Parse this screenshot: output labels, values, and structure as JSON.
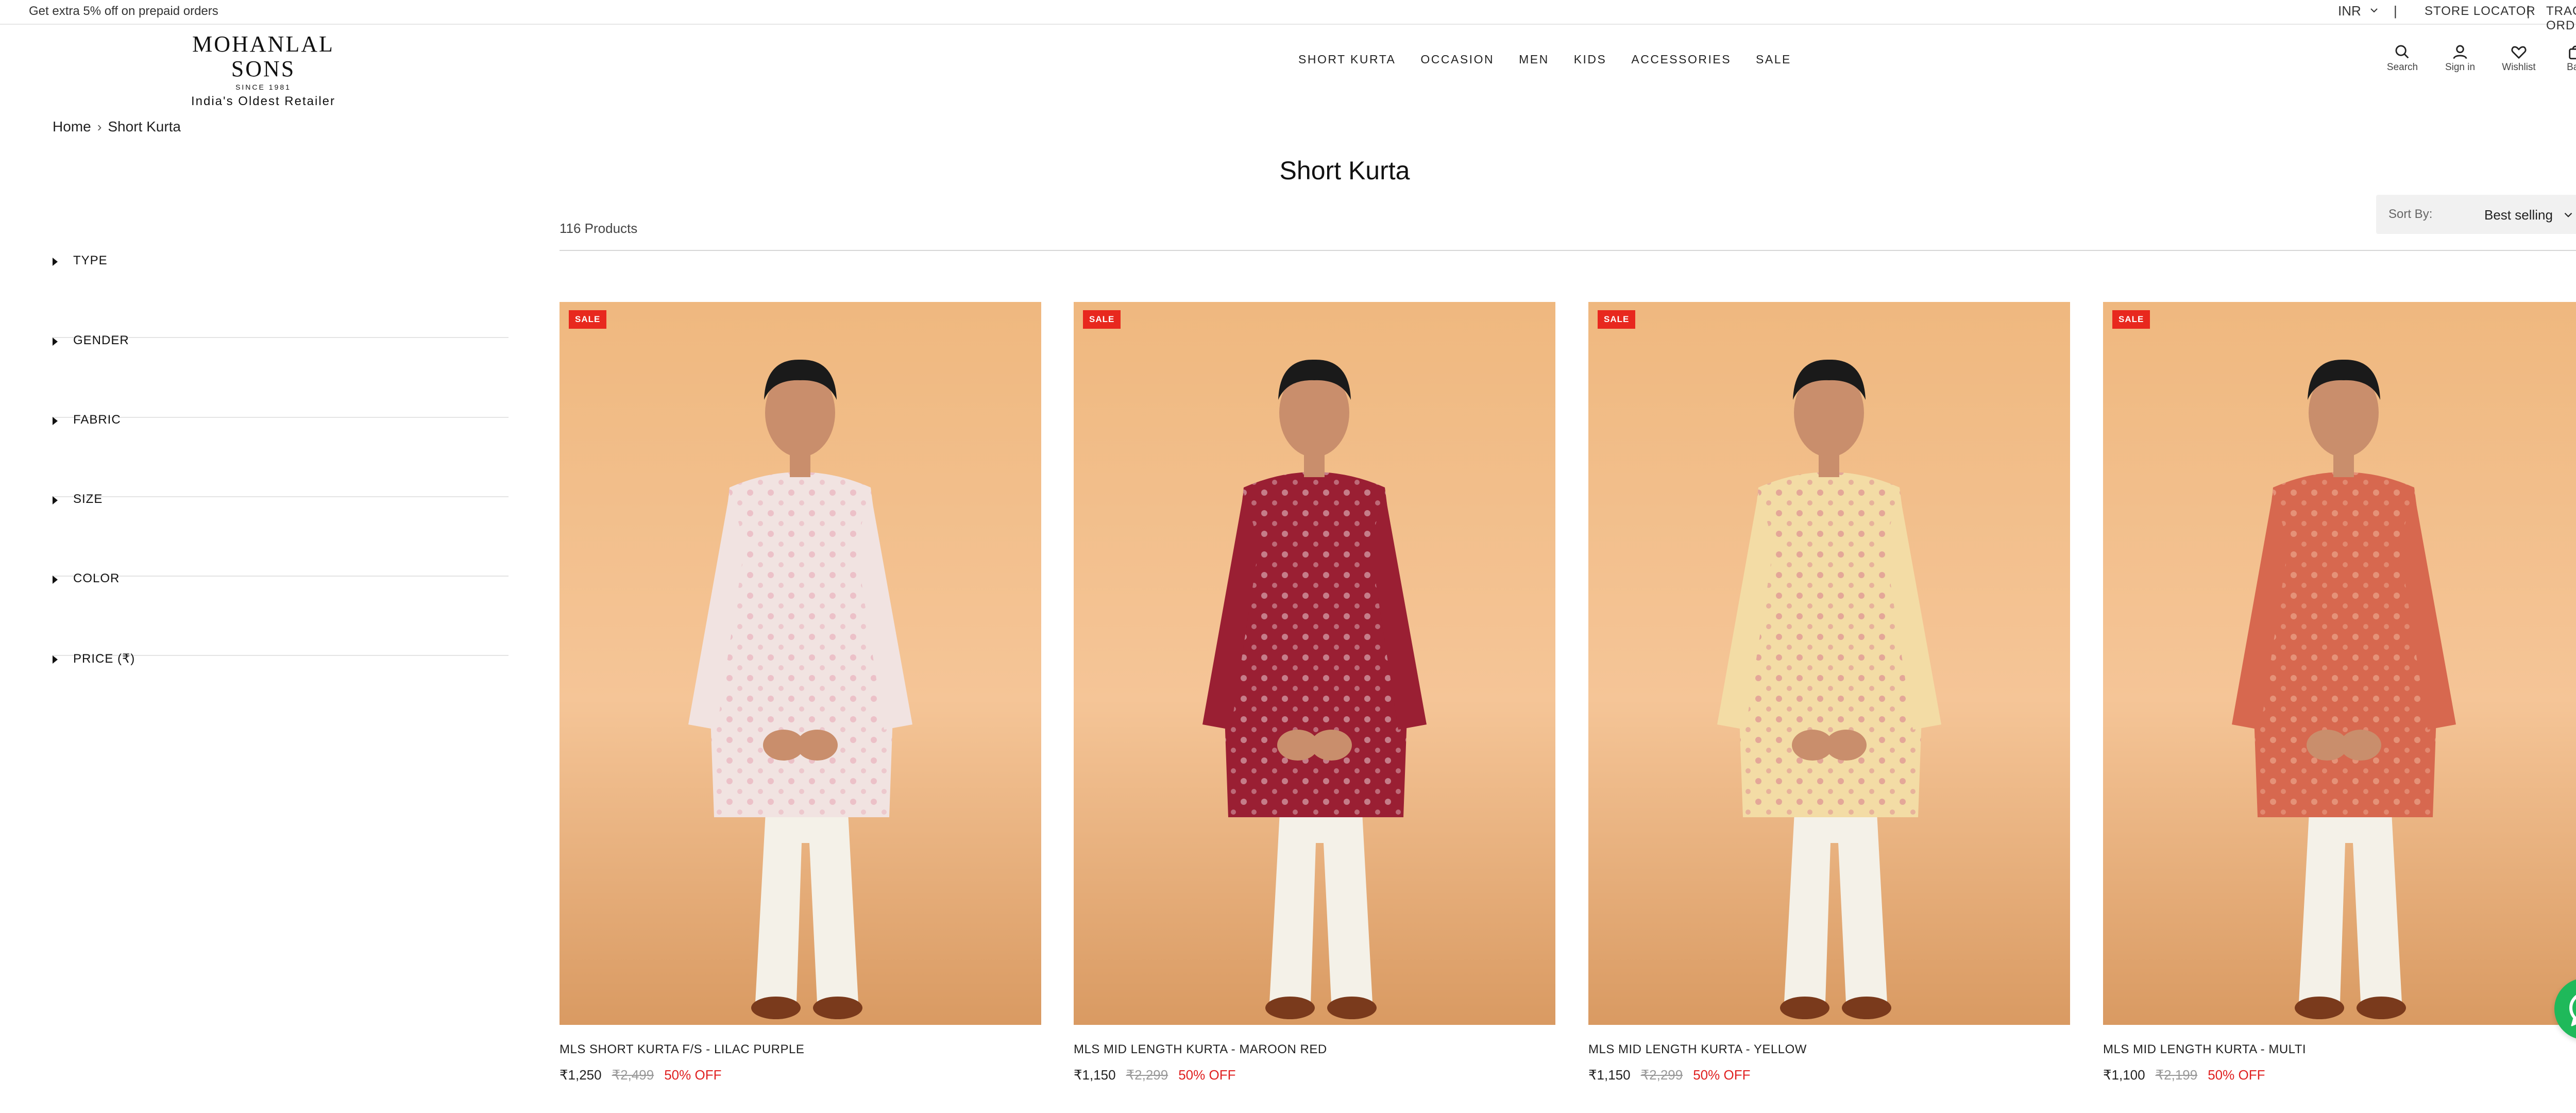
{
  "announcement": "Get extra 5% off on prepaid orders",
  "topbar": {
    "currency": "INR",
    "separator": "|",
    "store_locator": "STORE LOCATOR",
    "track_order": "TRACK ORDER"
  },
  "logo": {
    "name": "MOHANLAL SONS",
    "since": "SINCE 1981",
    "tagline": "India's Oldest Retailer"
  },
  "nav": [
    "SHORT KURTA",
    "OCCASION",
    "MEN",
    "KIDS",
    "ACCESSORIES",
    "SALE"
  ],
  "header_icons": {
    "search": "Search",
    "signin": "Sign in",
    "wishlist": "Wishlist",
    "bag": "Bag"
  },
  "breadcrumb": {
    "home": "Home",
    "current": "Short Kurta"
  },
  "page_title": "Short Kurta",
  "filters": [
    "TYPE",
    "GENDER",
    "FABRIC",
    "SIZE",
    "COLOR",
    "PRICE (₹)"
  ],
  "product_count": "116 Products",
  "sort": {
    "label": "Sort By:",
    "value": "Best selling"
  },
  "products": [
    {
      "badge": "SALE",
      "name": "MLS SHORT KURTA F/S - LILAC PURPLE",
      "price": "₹1,250",
      "compare": "₹2,499",
      "discount": "50% OFF",
      "kurta_color": "#f1e3e1",
      "pattern_color": "#e7a5b4"
    },
    {
      "badge": "SALE",
      "name": "MLS MID LENGTH KURTA - MAROON RED",
      "price": "₹1,150",
      "compare": "₹2,299",
      "discount": "50% OFF",
      "kurta_color": "#9a1f33",
      "pattern_color": "#e9c9cf"
    },
    {
      "badge": "SALE",
      "name": "MLS MID LENGTH KURTA - YELLOW",
      "price": "₹1,150",
      "compare": "₹2,299",
      "discount": "50% OFF",
      "kurta_color": "#f3dca5",
      "pattern_color": "#d77c8e"
    },
    {
      "badge": "SALE",
      "name": "MLS MID LENGTH KURTA - MULTI",
      "price": "₹1,100",
      "compare": "₹2,199",
      "discount": "50% OFF",
      "kurta_color": "#d7684f",
      "pattern_color": "#f0b49a"
    }
  ],
  "whatsapp_badge": "1",
  "colors": {
    "sale_badge": "#e8281e",
    "discount_text": "#e02020",
    "whatsapp": "#1fb95a",
    "photo_background": "#efb87f"
  }
}
